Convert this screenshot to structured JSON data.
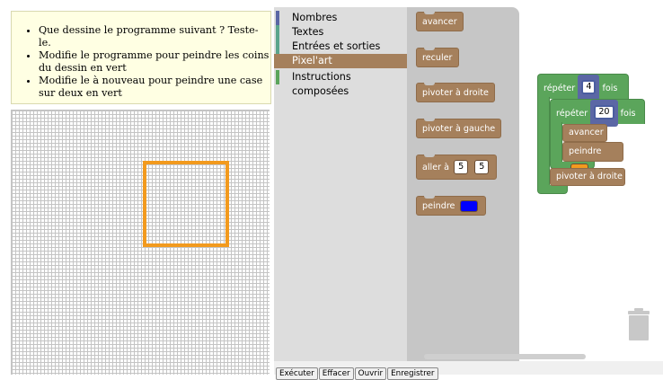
{
  "instructions": {
    "items": [
      "Que dessine le programme suivant ? Teste-le.",
      "Modifie le programme pour peindre les coins du dessin en vert",
      "Modifie le à nouveau pour peindre une case sur deux en vert"
    ]
  },
  "toolbox": {
    "categories": [
      {
        "label": "Nombres",
        "color": "#5b67a5"
      },
      {
        "label": "Textes",
        "color": "#5ba58c"
      },
      {
        "label": "Entrées et sorties",
        "color": "#5ba58c"
      },
      {
        "label": "Pixel'art",
        "color": "#a5805c",
        "selected": true
      },
      {
        "label": "Instructions composées",
        "color": "#5ba55b"
      }
    ]
  },
  "flyout": {
    "avancer": "avancer",
    "reculer": "reculer",
    "pivoter_droite": "pivoter à droite",
    "pivoter_gauche": "pivoter à gauche",
    "aller_a": "aller à",
    "aller_x": "5",
    "aller_y": "5",
    "peindre": "peindre"
  },
  "workspace": {
    "repeat_outer_label": "répéter",
    "repeat_outer_count": "4",
    "repeat_outer_suffix": "fois",
    "repeat_inner_label": "répéter",
    "repeat_inner_count": "20",
    "repeat_inner_suffix": "fois",
    "avancer": "avancer",
    "peindre": "peindre",
    "pivoter": "pivoter à droite"
  },
  "colors": {
    "paint_orange": "#f29a1e",
    "paint_blue": "#0000ff",
    "block_green": "#5ba55b",
    "block_brown": "#a5805c"
  },
  "buttons": {
    "run": "Exécuter",
    "clear": "Effacer",
    "open": "Ouvrir",
    "save": "Enregistrer"
  }
}
